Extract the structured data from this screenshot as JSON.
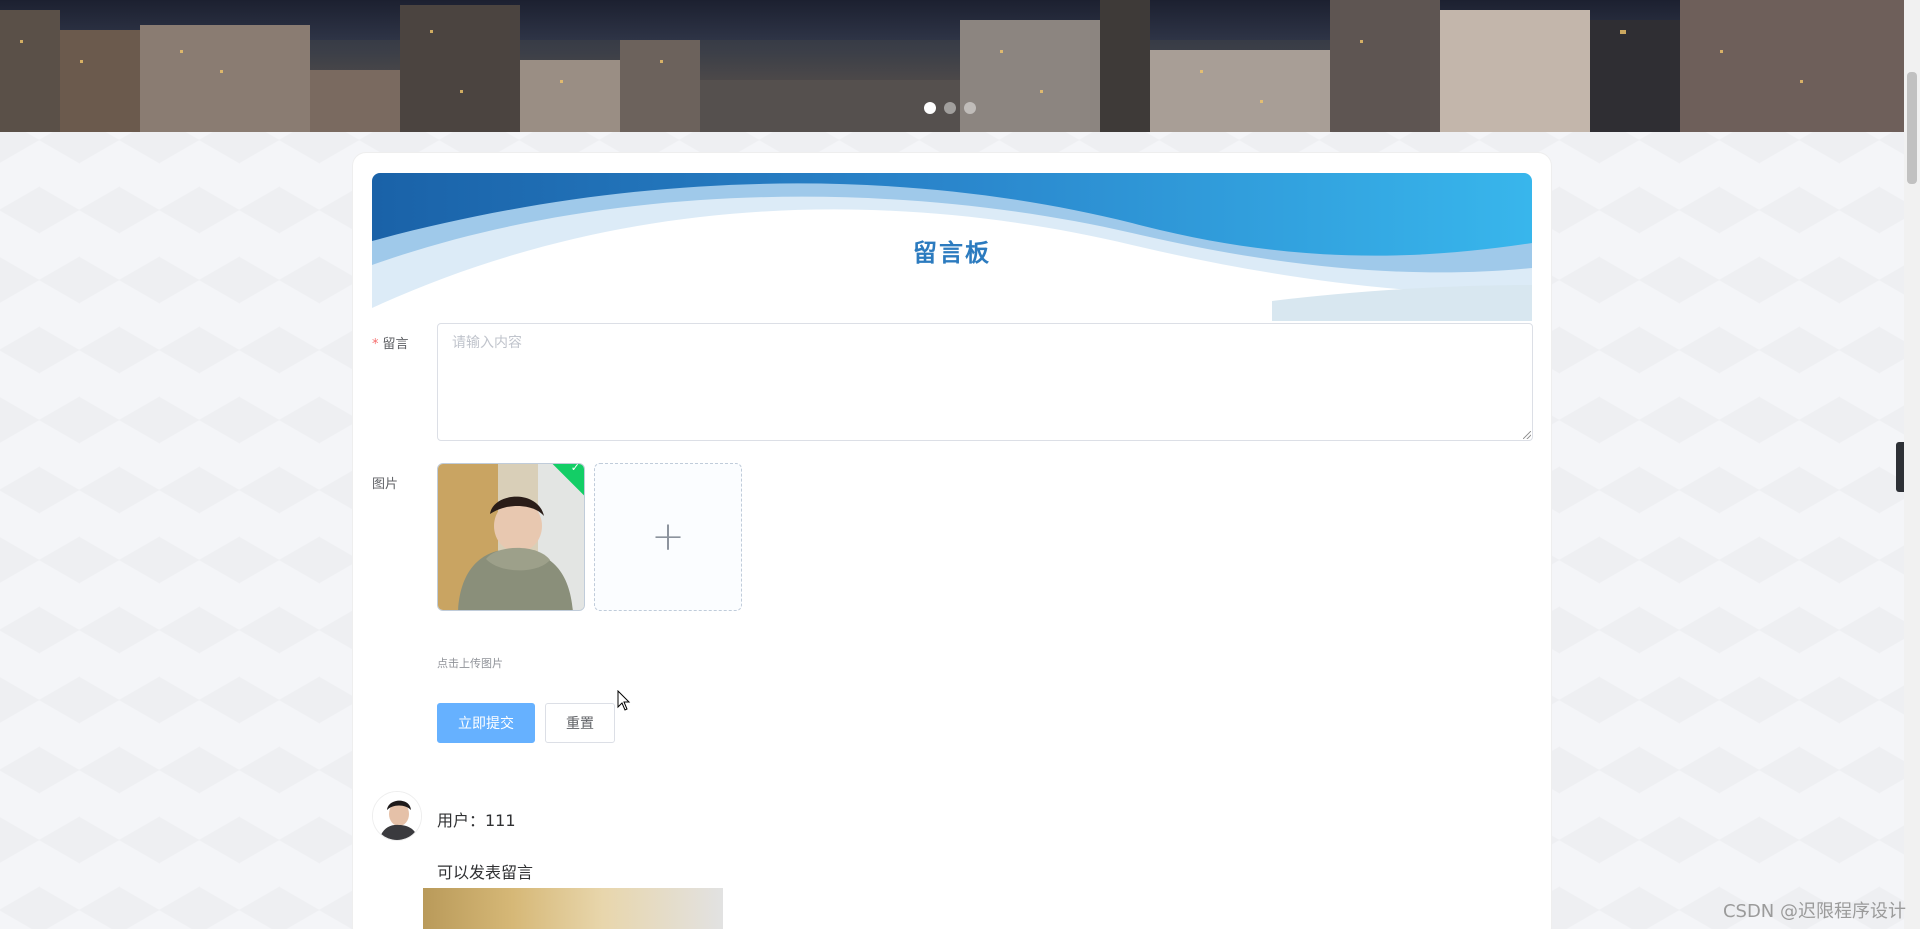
{
  "banner": {
    "slides": 3,
    "active_slide": 1
  },
  "board": {
    "title": "留言板"
  },
  "form": {
    "message_label": "留言",
    "message_placeholder": "请输入内容",
    "image_label": "图片",
    "upload_tip": "点击上传图片",
    "submit_label": "立即提交",
    "reset_label": "重置"
  },
  "messages": [
    {
      "user_line": "用户：111",
      "content": "可以发表留言"
    }
  ],
  "watermark": "CSDN @迟限程序设计",
  "colors": {
    "primary_button": "#66b1ff",
    "title": "#2c7bbf",
    "success_check": "#13ce66"
  }
}
